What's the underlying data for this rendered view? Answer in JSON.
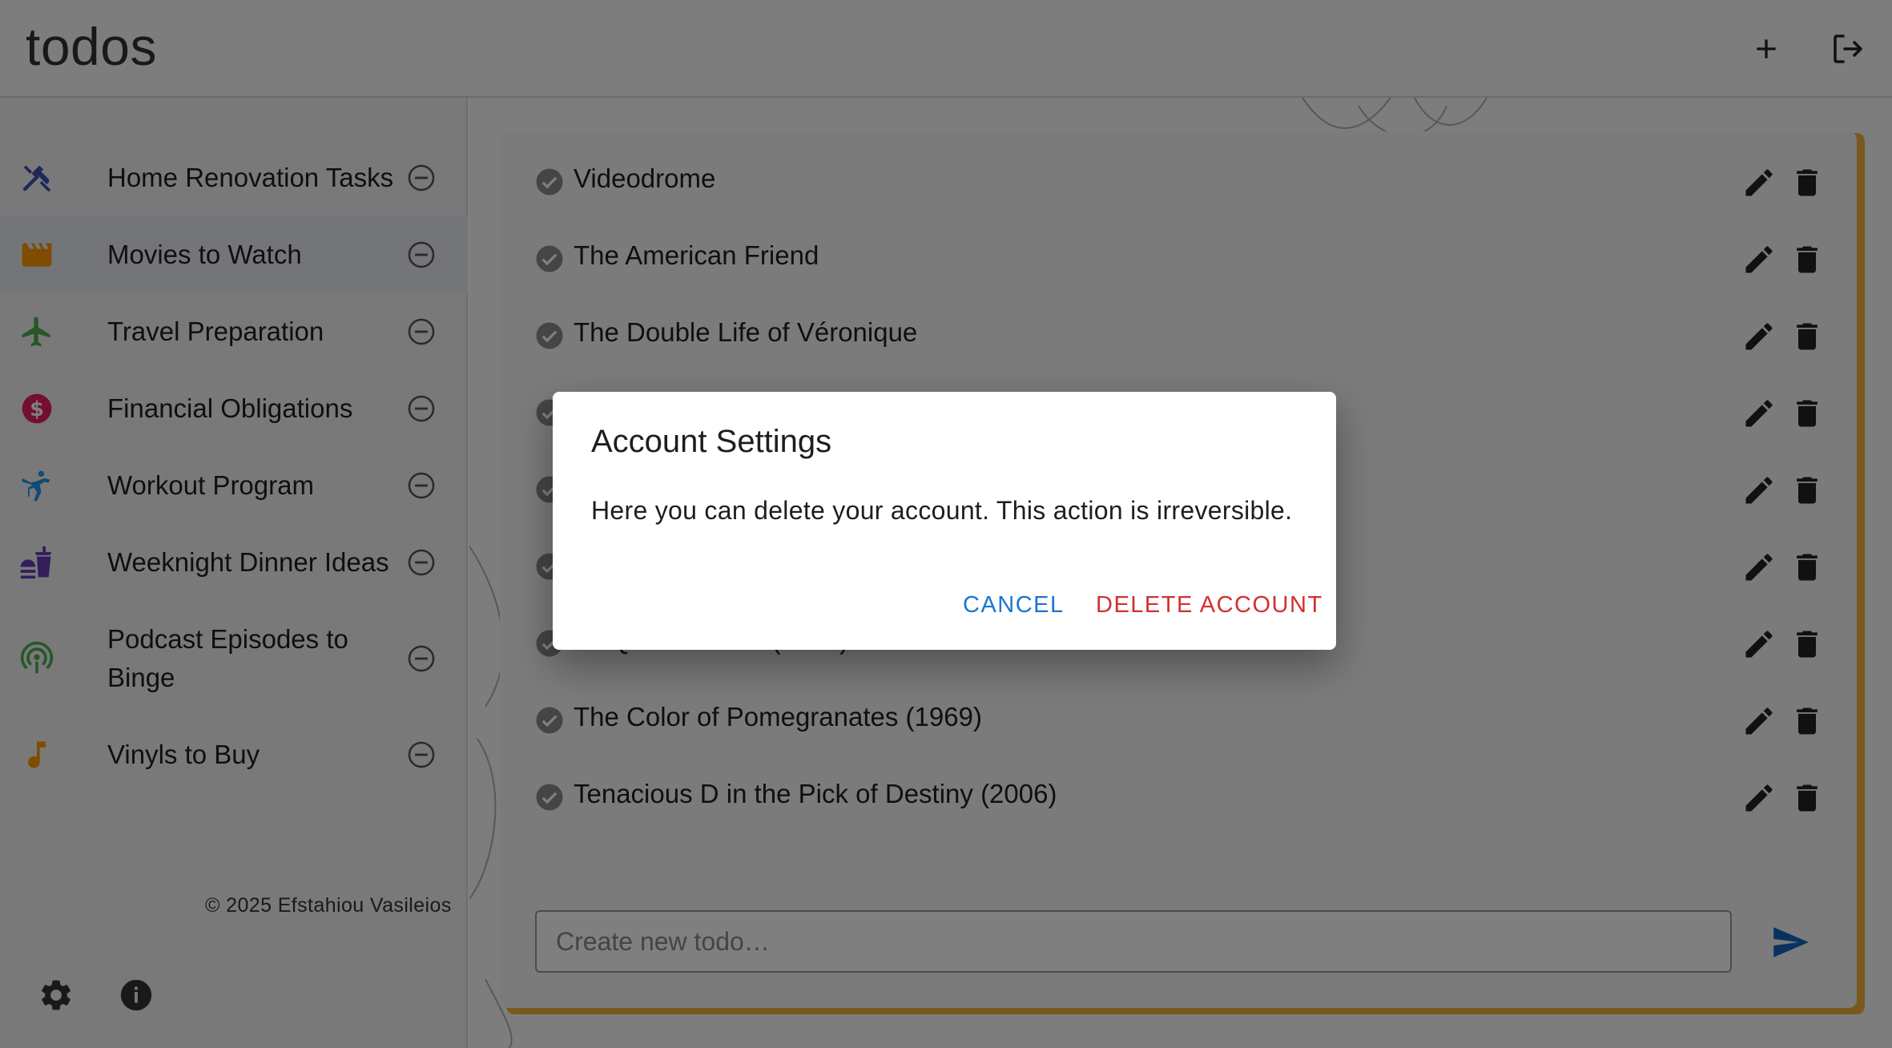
{
  "app": {
    "title": "todos"
  },
  "header": {
    "add_icon": "plus-icon",
    "logout_icon": "logout-icon"
  },
  "sidebar": {
    "lists": [
      {
        "label": "Home Renovation Tasks",
        "icon": "tools-icon",
        "color": "#3f51b5",
        "active": false
      },
      {
        "label": "Movies to Watch",
        "icon": "clapperboard-icon",
        "color": "#ff9800",
        "active": true
      },
      {
        "label": "Travel Preparation",
        "icon": "airplane-icon",
        "color": "#4caf50",
        "active": false
      },
      {
        "label": "Financial Obligations",
        "icon": "dollar-icon",
        "color": "#e91e63",
        "active": false
      },
      {
        "label": "Workout Program",
        "icon": "karate-icon",
        "color": "#2196f3",
        "active": false
      },
      {
        "label": "Weeknight Dinner Ideas",
        "icon": "fastfood-icon",
        "color": "#673ab7",
        "active": false
      },
      {
        "label": "Podcast Episodes to Binge",
        "icon": "podcast-icon",
        "color": "#4caf50",
        "active": false
      },
      {
        "label": "Vinyls to Buy",
        "icon": "music-note-icon",
        "color": "#ff9800",
        "active": false
      }
    ],
    "footer": {
      "settings_icon": "gear-icon",
      "info_icon": "info-icon",
      "copyright": "© 2025 Efstahiou Vasileios"
    }
  },
  "todos": {
    "items": [
      {
        "text": "Videodrome"
      },
      {
        "text": "The American Friend"
      },
      {
        "text": "The Double Life of Véronique"
      },
      {
        "text": ""
      },
      {
        "text": ""
      },
      {
        "text": ""
      },
      {
        "text": "Le Quattro Volte (2010)"
      },
      {
        "text": "The Color of Pomegranates (1969)"
      },
      {
        "text": "Tenacious D in the Pick of Destiny (2006)"
      }
    ],
    "input_placeholder": "Create new todo…",
    "accent_color": "#f2b23b"
  },
  "dialog": {
    "title": "Account Settings",
    "text": "Here you can delete your account. This action is irreversible.",
    "cancel_label": "CANCEL",
    "delete_label": "DELETE ACCOUNT"
  }
}
